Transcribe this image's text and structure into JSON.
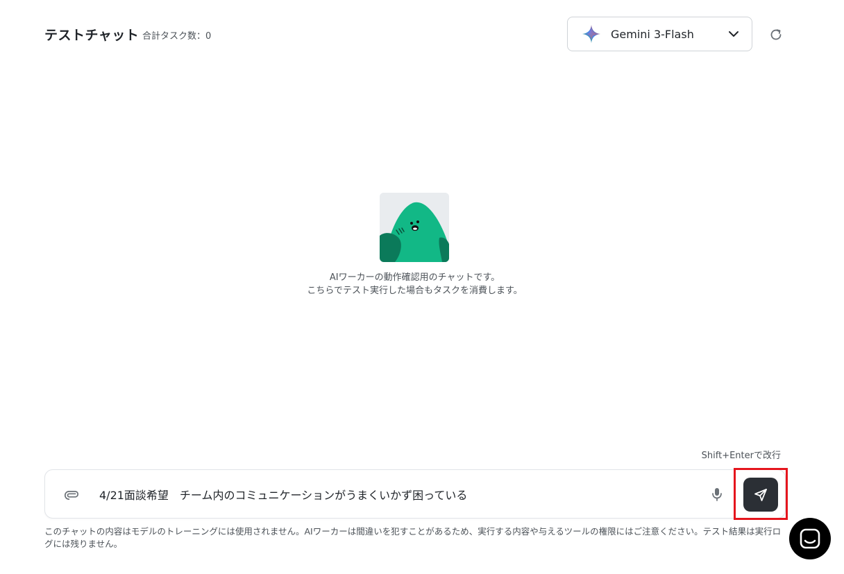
{
  "header": {
    "title": "テストチャット",
    "task_count": "合計タスク数：0",
    "model": {
      "label": "Gemini 3-Flash",
      "icon": "gemini-sparkle-icon"
    },
    "refresh_icon": "refresh-icon"
  },
  "intro": {
    "line1": "AIワーカーの動作確認用のチャットです。",
    "line2": "こちらでテスト実行した場合もタスクを消費します。"
  },
  "composer": {
    "hint": "Shift+Enterで改行",
    "value": "4/21面談希望　チーム内のコミュニケーションがうまくいかず困っている",
    "attach_icon": "paperclip-icon",
    "mic_icon": "microphone-icon",
    "send_icon": "send-icon"
  },
  "disclaimer": "このチャットの内容はモデルのトレーニングには使用されません。AIワーカーは間違いを犯すことがあるため、実行する内容や与えるツールの権限にはご注意ください。テスト結果は実行ログには残りません。",
  "colors": {
    "send_button": "#2b2f35",
    "highlight": "#e5151d",
    "mascot": "#12b886"
  }
}
